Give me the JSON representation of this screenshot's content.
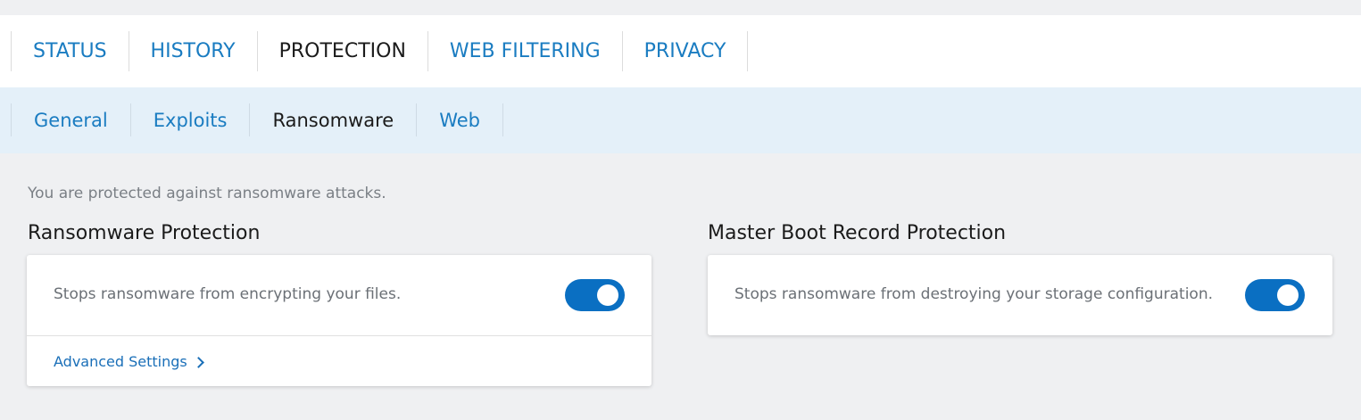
{
  "main_tabs": [
    {
      "label": "STATUS",
      "active": false
    },
    {
      "label": "HISTORY",
      "active": false
    },
    {
      "label": "PROTECTION",
      "active": true
    },
    {
      "label": "WEB FILTERING",
      "active": false
    },
    {
      "label": "PRIVACY",
      "active": false
    }
  ],
  "sub_tabs": [
    {
      "label": "General",
      "active": false
    },
    {
      "label": "Exploits",
      "active": false
    },
    {
      "label": "Ransomware",
      "active": true
    },
    {
      "label": "Web",
      "active": false
    }
  ],
  "status_message": "You are protected against ransomware attacks.",
  "ransomware": {
    "title": "Ransomware Protection",
    "description": "Stops ransomware from encrypting your files.",
    "enabled": true,
    "advanced_link": "Advanced Settings"
  },
  "mbr": {
    "title": "Master Boot Record Protection",
    "description": "Stops ransomware from destroying your storage configuration.",
    "enabled": true
  },
  "colors": {
    "accent": "#1a7cc1",
    "toggle_on": "#0a6fc2",
    "subbar_bg": "#e4f0f9",
    "page_bg": "#eff0f2"
  }
}
